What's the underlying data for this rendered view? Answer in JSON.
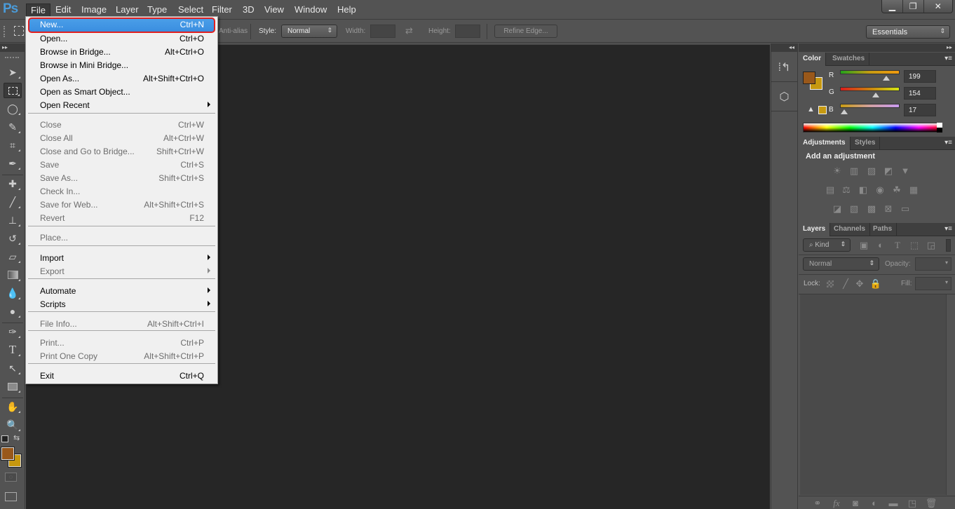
{
  "app": {
    "logo": "Ps"
  },
  "menubar": [
    "File",
    "Edit",
    "Image",
    "Layer",
    "Type",
    "Select",
    "Filter",
    "3D",
    "View",
    "Window",
    "Help"
  ],
  "window_controls": {
    "minimize": "▁",
    "restore": "❐",
    "close": "✕"
  },
  "options_bar": {
    "anti_alias": "Anti-alias",
    "style_label": "Style:",
    "style_value": "Normal",
    "width_label": "Width:",
    "height_label": "Height:",
    "refine_edge": "Refine Edge...",
    "workspace": "Essentials"
  },
  "file_menu": {
    "items": [
      {
        "label": "New...",
        "shortcut": "Ctrl+N",
        "enabled": true,
        "highlighted": true
      },
      {
        "label": "Open...",
        "shortcut": "Ctrl+O",
        "enabled": true
      },
      {
        "label": "Browse in Bridge...",
        "shortcut": "Alt+Ctrl+O",
        "enabled": true
      },
      {
        "label": "Browse in Mini Bridge...",
        "shortcut": "",
        "enabled": true
      },
      {
        "label": "Open As...",
        "shortcut": "Alt+Shift+Ctrl+O",
        "enabled": true
      },
      {
        "label": "Open as Smart Object...",
        "shortcut": "",
        "enabled": true
      },
      {
        "label": "Open Recent",
        "shortcut": "",
        "enabled": true,
        "submenu": true
      },
      {
        "label": "Close",
        "shortcut": "Ctrl+W",
        "enabled": false
      },
      {
        "label": "Close All",
        "shortcut": "Alt+Ctrl+W",
        "enabled": false
      },
      {
        "label": "Close and Go to Bridge...",
        "shortcut": "Shift+Ctrl+W",
        "enabled": false
      },
      {
        "label": "Save",
        "shortcut": "Ctrl+S",
        "enabled": false
      },
      {
        "label": "Save As...",
        "shortcut": "Shift+Ctrl+S",
        "enabled": false
      },
      {
        "label": "Check In...",
        "shortcut": "",
        "enabled": false
      },
      {
        "label": "Save for Web...",
        "shortcut": "Alt+Shift+Ctrl+S",
        "enabled": false
      },
      {
        "label": "Revert",
        "shortcut": "F12",
        "enabled": false
      },
      {
        "label": "Place...",
        "shortcut": "",
        "enabled": false
      },
      {
        "label": "Import",
        "shortcut": "",
        "enabled": true,
        "submenu": true
      },
      {
        "label": "Export",
        "shortcut": "",
        "enabled": false,
        "submenu": true
      },
      {
        "label": "Automate",
        "shortcut": "",
        "enabled": true,
        "submenu": true
      },
      {
        "label": "Scripts",
        "shortcut": "",
        "enabled": true,
        "submenu": true
      },
      {
        "label": "File Info...",
        "shortcut": "Alt+Shift+Ctrl+I",
        "enabled": false
      },
      {
        "label": "Print...",
        "shortcut": "Ctrl+P",
        "enabled": false
      },
      {
        "label": "Print One Copy",
        "shortcut": "Alt+Shift+Ctrl+P",
        "enabled": false
      },
      {
        "label": "Exit",
        "shortcut": "Ctrl+Q",
        "enabled": true
      }
    ]
  },
  "tools": [
    "move-tool",
    "rectangular-marquee-tool",
    "lasso-tool",
    "quick-selection-tool",
    "crop-tool",
    "eyedropper-tool",
    "spot-healing-brush-tool",
    "brush-tool",
    "clone-stamp-tool",
    "history-brush-tool",
    "eraser-tool",
    "gradient-tool",
    "blur-tool",
    "dodge-tool",
    "pen-tool",
    "type-tool",
    "path-selection-tool",
    "rectangle-tool",
    "hand-tool",
    "zoom-tool"
  ],
  "colors": {
    "foreground": "#99581a",
    "background": "#c7980f",
    "current": "#c79a11"
  },
  "color_panel": {
    "tabs": [
      "Color",
      "Swatches"
    ],
    "channels": [
      {
        "label": "R",
        "value": "199",
        "fraction": 0.78
      },
      {
        "label": "G",
        "value": "154",
        "fraction": 0.6
      },
      {
        "label": "B",
        "value": "17",
        "fraction": 0.07
      }
    ]
  },
  "adjustments_panel": {
    "tabs": [
      "Adjustments",
      "Styles"
    ],
    "title": "Add an adjustment",
    "icons": [
      [
        "brightness-contrast-icon",
        "levels-icon",
        "curves-icon",
        "exposure-icon",
        "vibrance-icon"
      ],
      [
        "hue-saturation-icon",
        "color-balance-icon",
        "black-white-icon",
        "photo-filter-icon",
        "channel-mixer-icon",
        "color-lookup-icon"
      ],
      [
        "invert-icon",
        "posterize-icon",
        "threshold-icon",
        "selective-color-icon",
        "gradient-map-icon"
      ]
    ]
  },
  "layers_panel": {
    "tabs": [
      "Layers",
      "Channels",
      "Paths"
    ],
    "filter_kind": "Kind",
    "blend_mode": "Normal",
    "opacity_label": "Opacity:",
    "lock_label": "Lock:",
    "fill_label": "Fill:"
  }
}
